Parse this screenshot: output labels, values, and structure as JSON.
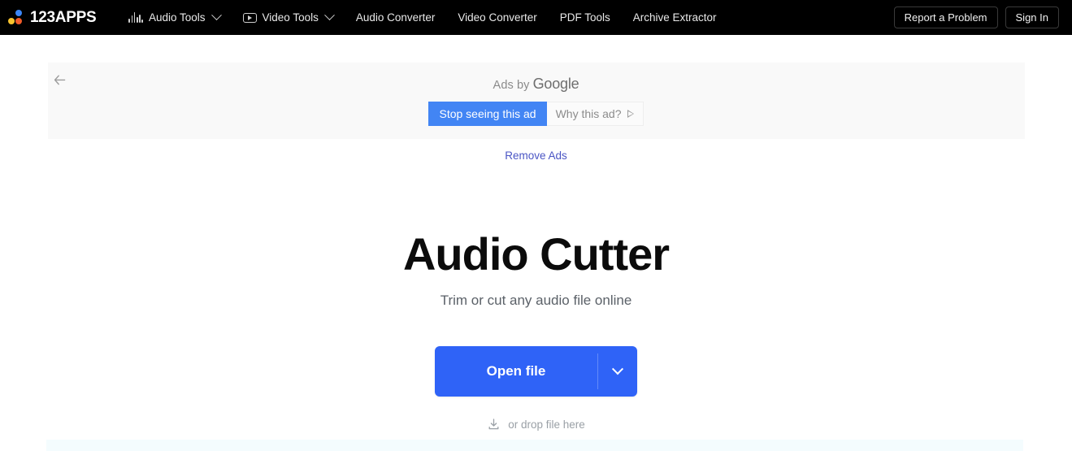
{
  "header": {
    "logo": {
      "text": "123APPS",
      "dots": [
        {
          "name": "blue",
          "color": "#3b86f7"
        },
        {
          "name": "yellow",
          "color": "#f7c32e"
        },
        {
          "name": "orange",
          "color": "#f05a28"
        }
      ]
    },
    "nav": [
      {
        "label": "Audio Tools",
        "icon": "equalizer-icon",
        "has_caret": true
      },
      {
        "label": "Video Tools",
        "icon": "video-play-icon",
        "has_caret": true
      },
      {
        "label": "Audio Converter",
        "icon": null,
        "has_caret": false
      },
      {
        "label": "Video Converter",
        "icon": null,
        "has_caret": false
      },
      {
        "label": "PDF Tools",
        "icon": null,
        "has_caret": false
      },
      {
        "label": "Archive Extractor",
        "icon": null,
        "has_caret": false
      }
    ],
    "report_label": "Report a Problem",
    "signin_label": "Sign In",
    "background": "#000000"
  },
  "ad": {
    "back_icon": "arrow-left-icon",
    "ads_by_prefix": "Ads by ",
    "ads_by_brand": "Google",
    "stop_label": "Stop seeing this ad",
    "why_label": "Why this ad?",
    "why_icon": "triangle-info-icon",
    "remove_ads_label": "Remove Ads",
    "stop_color": "#4285f4",
    "remove_ads_color": "#4a55c4",
    "background": "#f9f9f9"
  },
  "main": {
    "title": "Audio Cutter",
    "subtitle": "Trim or cut any audio file online",
    "open_file_label": "Open file",
    "open_caret_icon": "chevron-down-icon",
    "drop_icon": "download-icon",
    "drop_label": "or drop file here",
    "accent_color": "#2f63f7"
  }
}
